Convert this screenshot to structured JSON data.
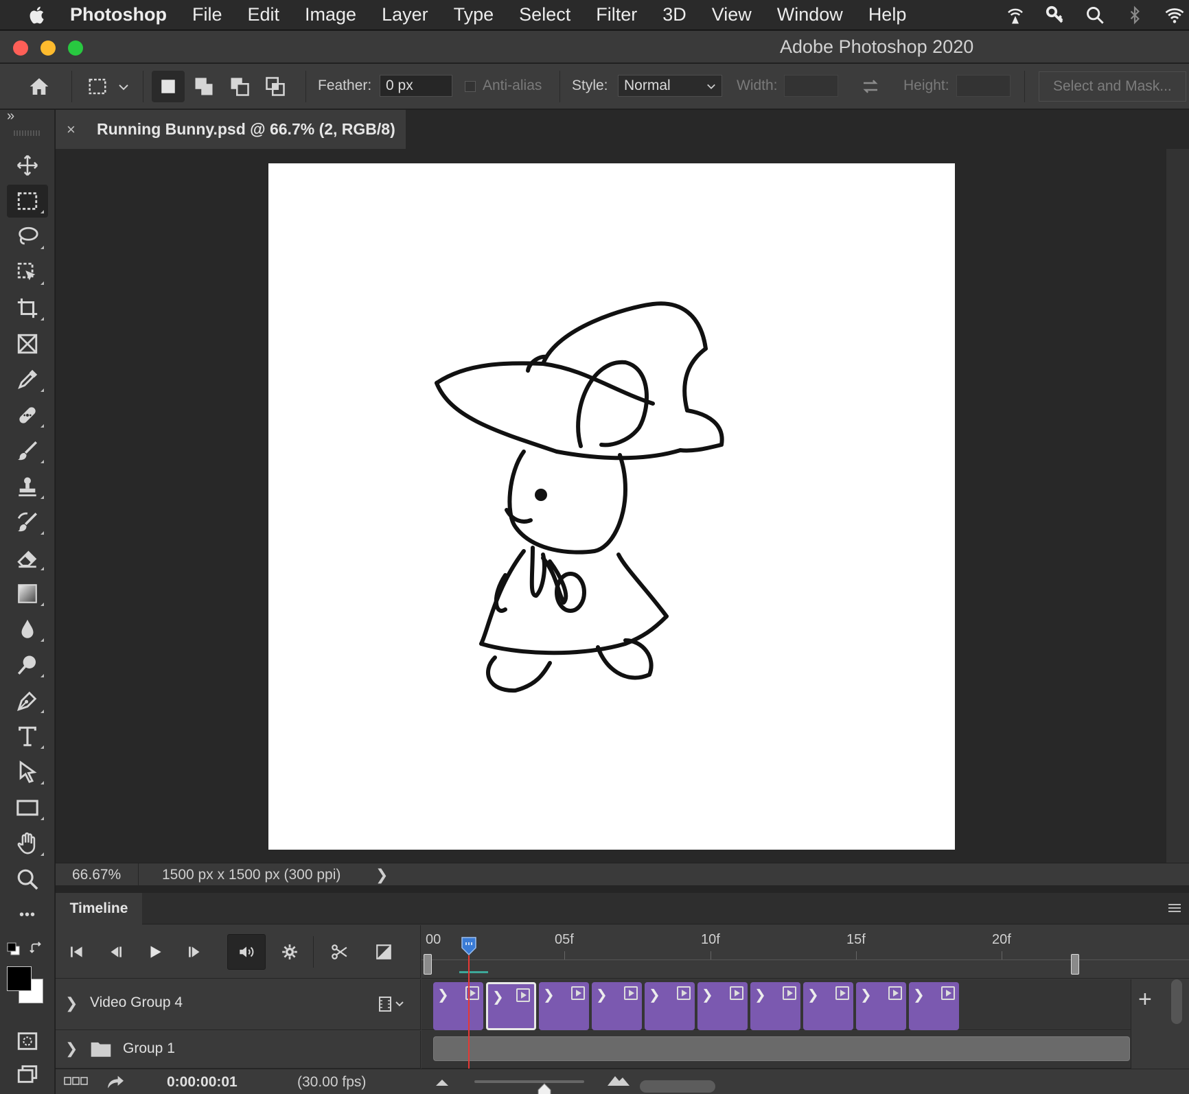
{
  "menubar": {
    "app_name": "Photoshop",
    "items": [
      "File",
      "Edit",
      "Image",
      "Layer",
      "Type",
      "Select",
      "Filter",
      "3D",
      "View",
      "Window",
      "Help"
    ],
    "status_icons": [
      "airdrop-icon",
      "key-icon",
      "search-icon",
      "bluetooth-icon",
      "wifi-icon"
    ]
  },
  "window": {
    "title": "Adobe Photoshop 2020",
    "traffic_colors": [
      "#fe5f57",
      "#febb2e",
      "#28c840"
    ]
  },
  "options": {
    "feather_label": "Feather:",
    "feather_value": "0 px",
    "antialias_label": "Anti-alias",
    "style_label": "Style:",
    "style_value": "Normal",
    "width_label": "Width:",
    "height_label": "Height:",
    "select_mask_label": "Select and Mask..."
  },
  "tools": {
    "collapse_glyph": "»",
    "items": [
      "move-tool",
      "rectangular-marquee-tool",
      "lasso-tool",
      "object-selection-tool",
      "crop-tool",
      "frame-tool",
      "eyedropper-tool",
      "spot-healing-brush-tool",
      "brush-tool",
      "clone-stamp-tool",
      "history-brush-tool",
      "eraser-tool",
      "gradient-tool",
      "blur-tool",
      "dodge-tool",
      "pen-tool",
      "type-tool",
      "path-selection-tool",
      "rectangle-tool",
      "hand-tool",
      "zoom-tool",
      "edit-toolbar"
    ],
    "more_glyph": "•••",
    "foreground_color": "#000000",
    "background_color": "#ffffff"
  },
  "document": {
    "tab_title": "Running Bunny.psd @ 66.7% (2, RGB/8)",
    "close_glyph": "×"
  },
  "status": {
    "zoom": "66.67%",
    "info": "1500 px x 1500 px (300 ppi)",
    "chevron": "❯"
  },
  "timeline": {
    "title": "Timeline",
    "ruler_labels": [
      "00",
      "05f",
      "10f",
      "15f",
      "20f"
    ],
    "tracks": [
      {
        "name": "Video Group 4",
        "frames": 10,
        "selected_frame": 2
      },
      {
        "name": "Group 1"
      }
    ],
    "add_glyph": "+",
    "timecode": "0:00:00:01",
    "fps": "(30.00 fps)",
    "playhead_frame": 1,
    "frame_glyph": "❯"
  }
}
